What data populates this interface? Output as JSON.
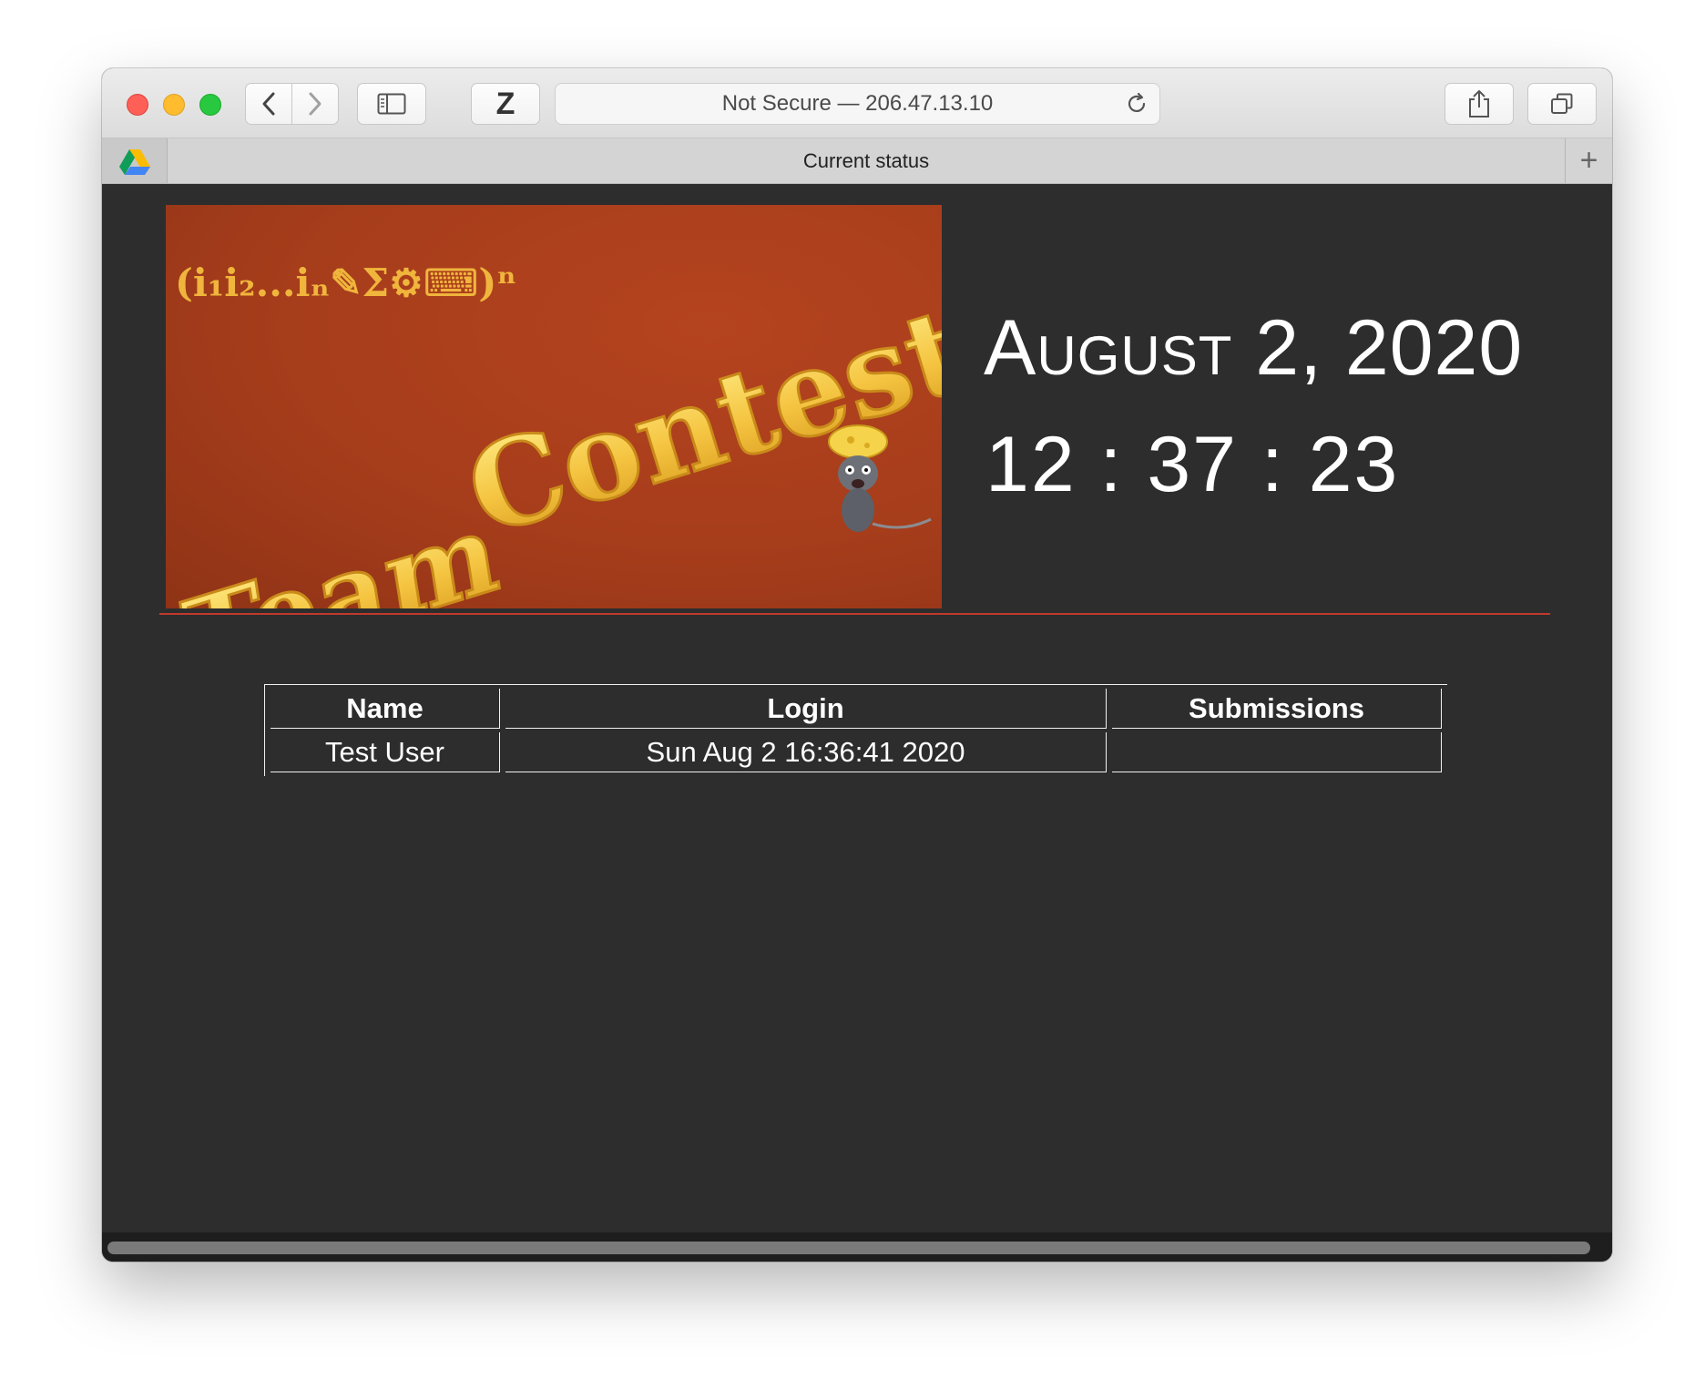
{
  "browser": {
    "address": "Not Secure — 206.47.13.10",
    "tab_title": "Current status",
    "extension_label": "Z",
    "new_tab_label": "+"
  },
  "banner": {
    "title_line1": "Team",
    "title_line2": "Contest",
    "formula": "(i₁i₂...iₙ✎Σ⚙⌨)ⁿ"
  },
  "clock": {
    "date": "August 2, 2020",
    "time": "12 : 37 : 23"
  },
  "table": {
    "headers": [
      "Name",
      "Login",
      "Submissions"
    ],
    "rows": [
      {
        "name": "Test User",
        "login": "Sun Aug 2 16:36:41 2020",
        "submissions": ""
      }
    ]
  },
  "colors": {
    "page_background": "#2d2d2d",
    "divider": "#c0392b",
    "banner_background": "#a63d1b",
    "cheese": "#f5c542"
  }
}
